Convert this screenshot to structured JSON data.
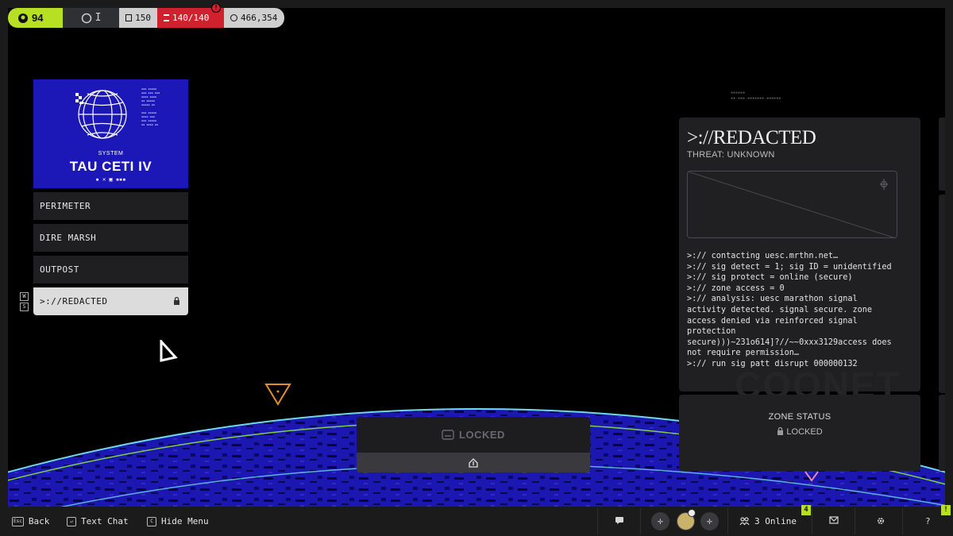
{
  "topbar": {
    "level": "94",
    "rank": "I",
    "capacity": "150",
    "vault": "140/140",
    "vault_alert": "!",
    "credits": "466,354"
  },
  "system": {
    "label": "SYSTEM",
    "name": "TAU CETI IV"
  },
  "zones": [
    {
      "label": "PERIMETER",
      "locked": false
    },
    {
      "label": "DIRE MARSH",
      "locked": false
    },
    {
      "label": "OUTPOST",
      "locked": false
    },
    {
      "label": ">://REDACTED",
      "locked": true
    }
  ],
  "key_hints": [
    "W",
    "S"
  ],
  "panel": {
    "title": ">://REDACTED",
    "threat": "THREAT: UNKNOWN",
    "log": ">:// contacting uesc.mrthn.net…\n>:// sig detect = 1; sig ID = unidentified\n>:// sig protect = online (secure)\n>:// zone access = 0\n>:// analysis: uesc marathon signal activity detected. signal secure. zone access denied via reinforced signal protection secure)))~231o614]?//~~0xxx3129access does not require permission…\n>:// run sig patt disrupt 000000132",
    "ghost_text": "COONET"
  },
  "zone_status": {
    "label": "ZONE STATUS",
    "value": "LOCKED"
  },
  "center_action": {
    "label": "LOCKED"
  },
  "bottombar": {
    "back_key": "Esc",
    "back_label": "Back",
    "chat_key": "↵",
    "chat_label": "Text Chat",
    "hide_key": "C",
    "hide_label": "Hide Menu",
    "online_label": "3 Online",
    "online_badge": "4",
    "help_label": "?",
    "alert_badge": "!"
  },
  "colors": {
    "accent": "#b6e021",
    "danger": "#d0212d",
    "planet": "#1c18b8",
    "orbit_green": "#7fd34a",
    "orbit_cyan": "#6fd8e8",
    "marker_orange": "#e0902a",
    "marker_pink": "#e08ab0"
  }
}
